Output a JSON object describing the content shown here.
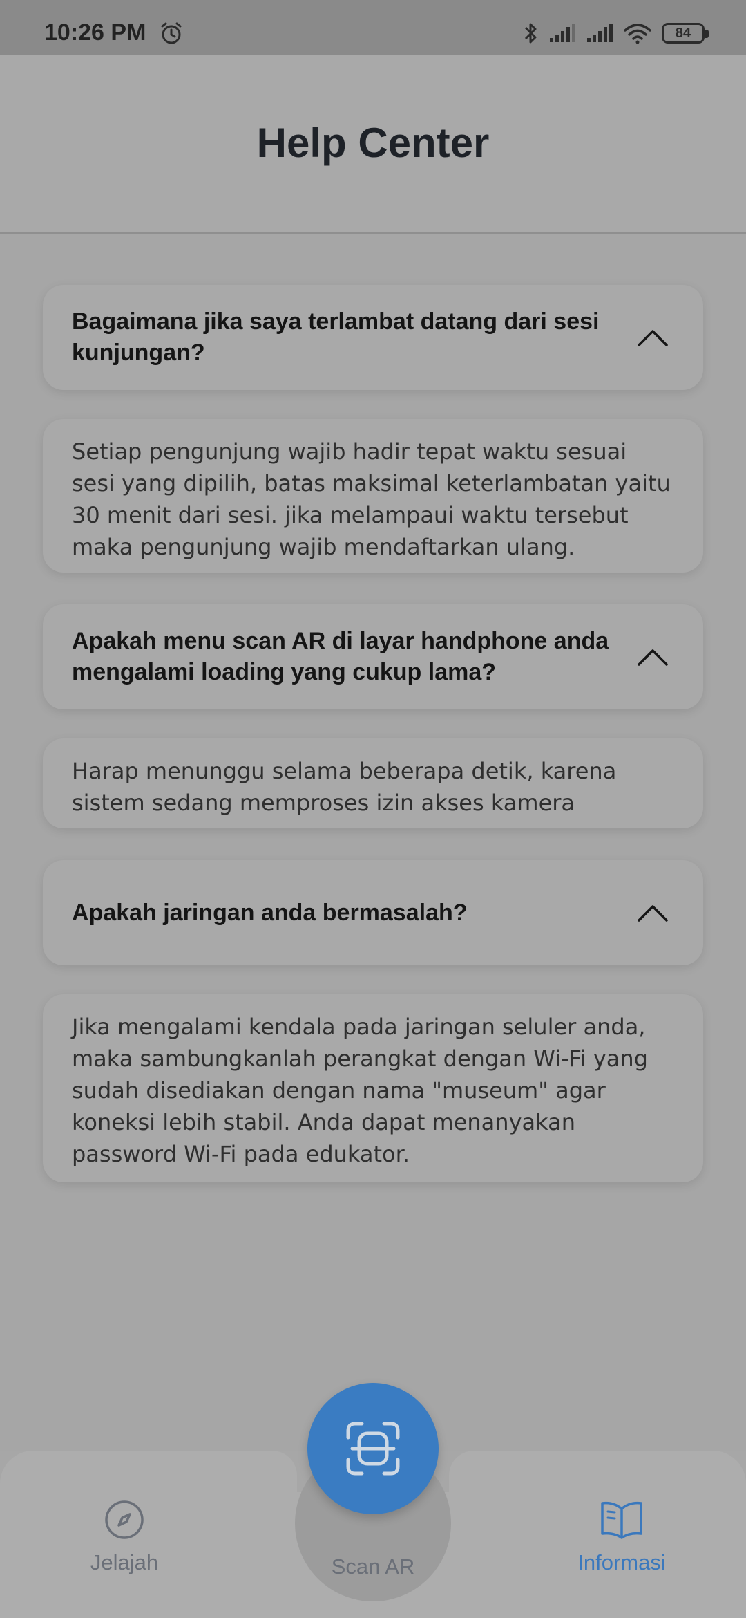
{
  "status_bar": {
    "time": "10:26 PM",
    "battery": "84"
  },
  "header": {
    "title": "Help Center"
  },
  "faq": [
    {
      "question": "Bagaimana jika saya terlambat datang dari sesi kunjungan?",
      "answer": "Setiap pengunjung wajib hadir tepat waktu sesuai sesi yang dipilih, batas maksimal keterlambatan yaitu 30 menit dari sesi. jika melampaui waktu tersebut maka pengunjung wajib mendaftarkan ulang."
    },
    {
      "question": "Apakah menu scan AR di layar handphone anda mengalami loading yang cukup lama?",
      "answer": "Harap menunggu selama beberapa detik, karena sistem sedang memproses izin akses kamera"
    },
    {
      "question": "Apakah jaringan anda bermasalah?",
      "answer": "Jika mengalami kendala pada jaringan seluler anda, maka sambungkanlah perangkat dengan Wi-Fi yang sudah disediakan dengan nama \"museum\" agar koneksi lebih stabil. Anda dapat menanyakan password Wi-Fi pada edukator."
    }
  ],
  "bottom_nav": {
    "items": [
      {
        "label": "Jelajah",
        "icon": "compass-icon",
        "active": false
      },
      {
        "label": "Scan AR",
        "icon": "scan-icon",
        "active": false
      },
      {
        "label": "Informasi",
        "icon": "book-icon",
        "active": true
      }
    ],
    "active_color": "#3a78bd",
    "inactive_color": "#6a6f78",
    "fab_color": "#3a7cc2"
  }
}
